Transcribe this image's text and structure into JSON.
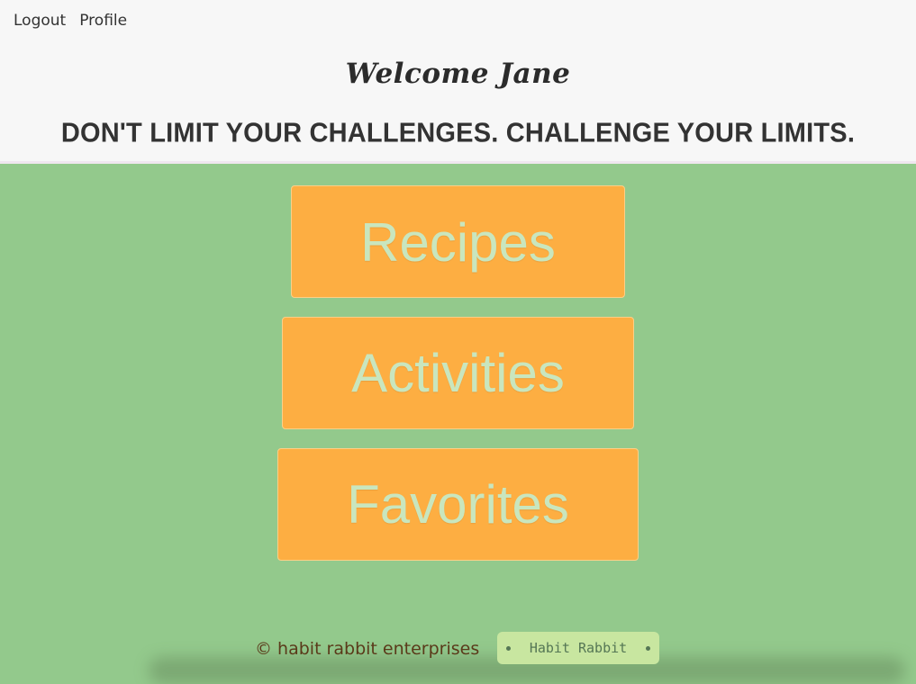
{
  "nav": {
    "logout": "Logout",
    "profile": "Profile"
  },
  "header": {
    "welcome": "Welcome Jane",
    "tagline": "DON'T LIMIT YOUR CHALLENGES. CHALLENGE YOUR LIMITS."
  },
  "menu": {
    "recipes": "Recipes",
    "activities": "Activities",
    "favorites": "Favorites"
  },
  "footer": {
    "copyright": "© habit rabbit enterprises",
    "brand": "Habit Rabbit"
  },
  "colors": {
    "background": "#93c98c",
    "header_bg": "#f7f7f7",
    "button_bg": "#fdae42",
    "button_text": "#c9e6be",
    "pill_bg": "#c8e6a0"
  }
}
